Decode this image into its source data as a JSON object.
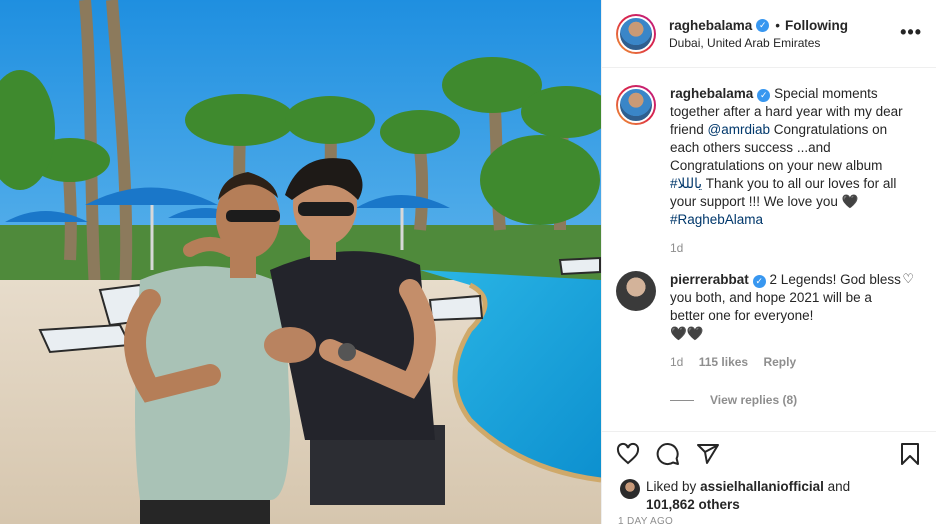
{
  "post": {
    "author": "raghebalama",
    "follow_status": "Following",
    "location": "Dubai, United Arab Emirates",
    "more_label": "•••",
    "caption": {
      "text_before": "Special moments together after a hard year with my dear friend",
      "mention": "@amrdiab",
      "text_middle": "Congratulations on each others success ...and Congratulations on your new album",
      "hashtag_album": "#ﻳﺎﻟﻠﻠﺎ",
      "text_after": "Thank you to all our loves for all your support !!! We love you",
      "hashtag_name": "#RaghebAlama",
      "age": "1d"
    },
    "comment": {
      "author": "pierrerabbat",
      "text": "2 Legends! God bless you both, and hope 2021 will be a better one for everyone!",
      "hearts": "🖤🖤",
      "age": "1d",
      "likes": "115 likes",
      "reply": "Reply",
      "view_replies": "View replies (8)"
    },
    "likes": {
      "prefix": "Liked by",
      "user": "assielhallaniofficial",
      "middle": "and",
      "count": "101,862 others"
    },
    "time_ago": "1 DAY AGO"
  },
  "icons": [
    "heart-icon",
    "comment-icon",
    "share-icon",
    "bookmark-icon",
    "verified-icon",
    "more-icon"
  ],
  "colors": {
    "accent": "#3897f0",
    "muted": "#8e8e8e",
    "mention": "#00376b"
  }
}
